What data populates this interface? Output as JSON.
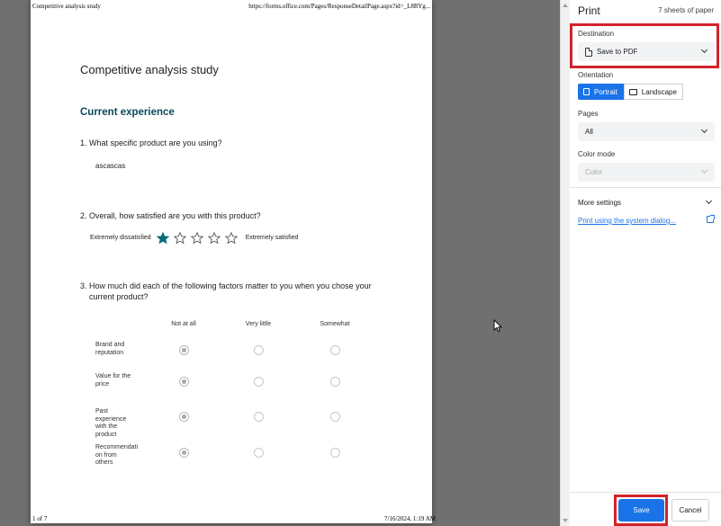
{
  "preview": {
    "header_left": "Competitive analysis study",
    "header_right": "https://forms.office.com/Pages/ResponseDetailPage.aspx?id=_L8RYg...",
    "footer_left": "1 of 7",
    "footer_right": "7/16/2024, 1:19 AM",
    "doc_title": "Competitive analysis study",
    "section_title": "Current experience",
    "q1": "1. What specific product are you using?",
    "a1": "ascascas",
    "q2": "2. Overall, how satisfied are you with this product?",
    "rating_low": "Extremely dissatisfied",
    "rating_high": "Extremely satisfied",
    "rating_value": 1,
    "rating_max": 5,
    "q3_line1": "3. How much did each of the following factors matter to you when you chose your",
    "q3_line2": "current product?",
    "columns": [
      "Not at all",
      "Very little",
      "Somewhat"
    ],
    "rows": [
      {
        "label": "Brand and reputation",
        "selected": 0
      },
      {
        "label": "Value for the price",
        "selected": 0
      },
      {
        "label": "Past experience with the product",
        "selected": 0
      },
      {
        "label": "Recommendati on from others",
        "selected": 0
      }
    ]
  },
  "panel": {
    "title": "Print",
    "sheets": "7 sheets of paper",
    "destination_label": "Destination",
    "destination_value": "Save to PDF",
    "orientation_label": "Orientation",
    "orientation_portrait": "Portrait",
    "orientation_landscape": "Landscape",
    "pages_label": "Pages",
    "pages_value": "All",
    "color_label": "Color mode",
    "color_value": "Color",
    "more_settings": "More settings",
    "system_dialog": "Print using the system dialog...",
    "save": "Save",
    "cancel": "Cancel"
  },
  "colors": {
    "accent": "#1a73e8",
    "highlight": "#d2232a",
    "section": "#0b4a5a",
    "star": "#0b6b78"
  }
}
